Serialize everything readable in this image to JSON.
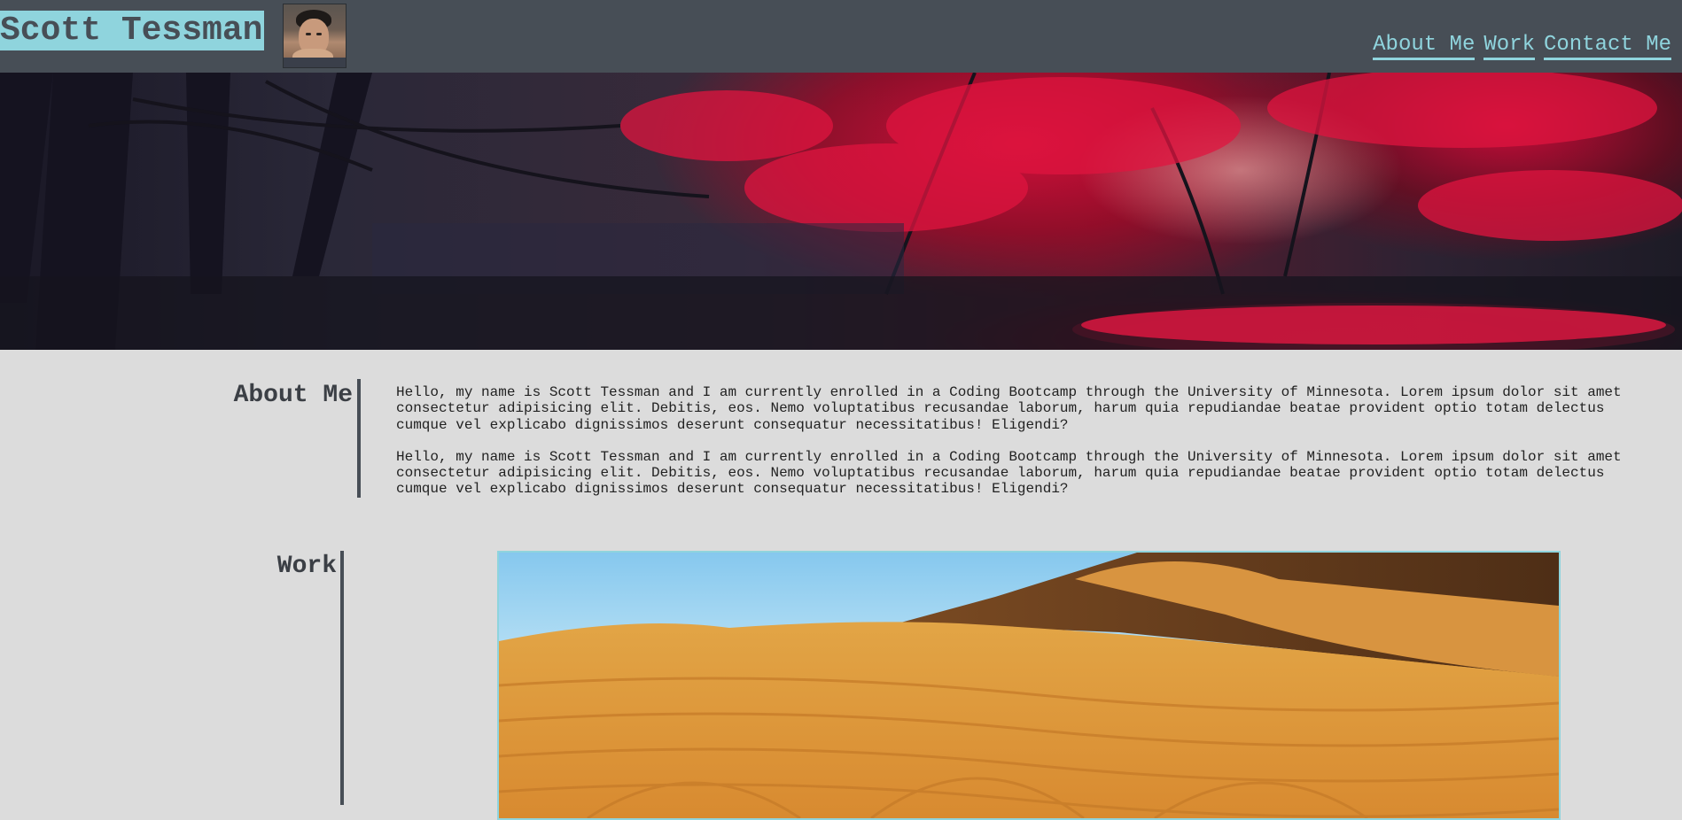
{
  "header": {
    "site_title": "Scott Tessman",
    "nav": [
      {
        "label": "About Me"
      },
      {
        "label": "Work"
      },
      {
        "label": "Contact Me"
      }
    ]
  },
  "about": {
    "heading": "About Me",
    "paragraphs": [
      "Hello, my name is Scott Tessman and I am currently enrolled in a Coding Bootcamp through the University of Minnesota. Lorem ipsum dolor sit amet consectetur adipisicing elit. Debitis, eos. Nemo voluptatibus recusandae laborum, harum quia repudiandae beatae provident optio totam delectus cumque vel explicabo dignissimos deserunt consequatur necessitatibus! Eligendi?",
      "Hello, my name is Scott Tessman and I am currently enrolled in a Coding Bootcamp through the University of Minnesota. Lorem ipsum dolor sit amet consectetur adipisicing elit. Debitis, eos. Nemo voluptatibus recusandae laborum, harum quia repudiandae beatae provident optio totam delectus cumque vel explicabo dignissimos deserunt consequatur necessitatibus! Eligendi?"
    ]
  },
  "work": {
    "heading": "Work"
  },
  "colors": {
    "header_bg": "#474e56",
    "accent": "#8fd4dd",
    "page_bg": "#dcdcdc"
  },
  "icons": {
    "avatar": "profile-photo",
    "hero": "red-forest-banner",
    "work_image": "desert-dunes-photo"
  }
}
